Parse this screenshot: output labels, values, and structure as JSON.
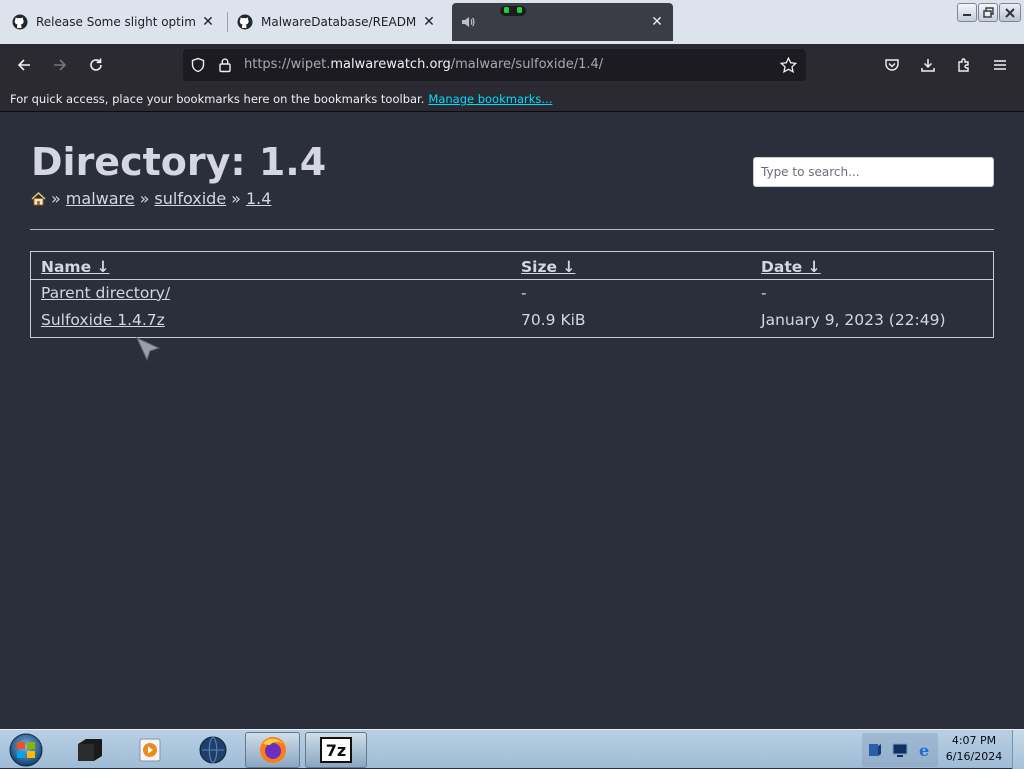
{
  "browser": {
    "tabs": [
      {
        "title": "Release Some slight optimalizat",
        "icon": "github-icon",
        "active": false
      },
      {
        "title": "MalwareDatabase/README.md",
        "icon": "github-icon",
        "active": false
      },
      {
        "title": "",
        "icon": "sound-playing-icon",
        "active": true
      }
    ],
    "url": {
      "prefix": "https://wipet.",
      "host": "malwarewatch.org",
      "suffix": "/malware/sulfoxide/1.4/"
    },
    "bookmarks_bar": {
      "text": "For quick access, place your bookmarks here on the bookmarks toolbar.",
      "link": "Manage bookmarks..."
    }
  },
  "page": {
    "title": "Directory: 1.4",
    "breadcrumb": {
      "sep": "»",
      "items": [
        "malware",
        "sulfoxide",
        "1.4"
      ]
    },
    "search": {
      "placeholder": "Type to search..."
    },
    "table": {
      "headers": [
        "Name ↓",
        "Size ↓",
        "Date ↓"
      ],
      "rows": [
        {
          "name": "Parent directory/",
          "size": "-",
          "date": "-"
        },
        {
          "name": "Sulfoxide 1.4.7z",
          "size": "70.9 KiB",
          "date": "January 9, 2023 (22:49)"
        }
      ]
    }
  },
  "taskbar": {
    "apps": [
      "media-center-icon",
      "media-player-icon",
      "globe-icon",
      "firefox-icon",
      "7zip-icon"
    ],
    "seven_zip_label": "7z",
    "clock": {
      "time": "4:07 PM",
      "date": "6/16/2024"
    }
  }
}
